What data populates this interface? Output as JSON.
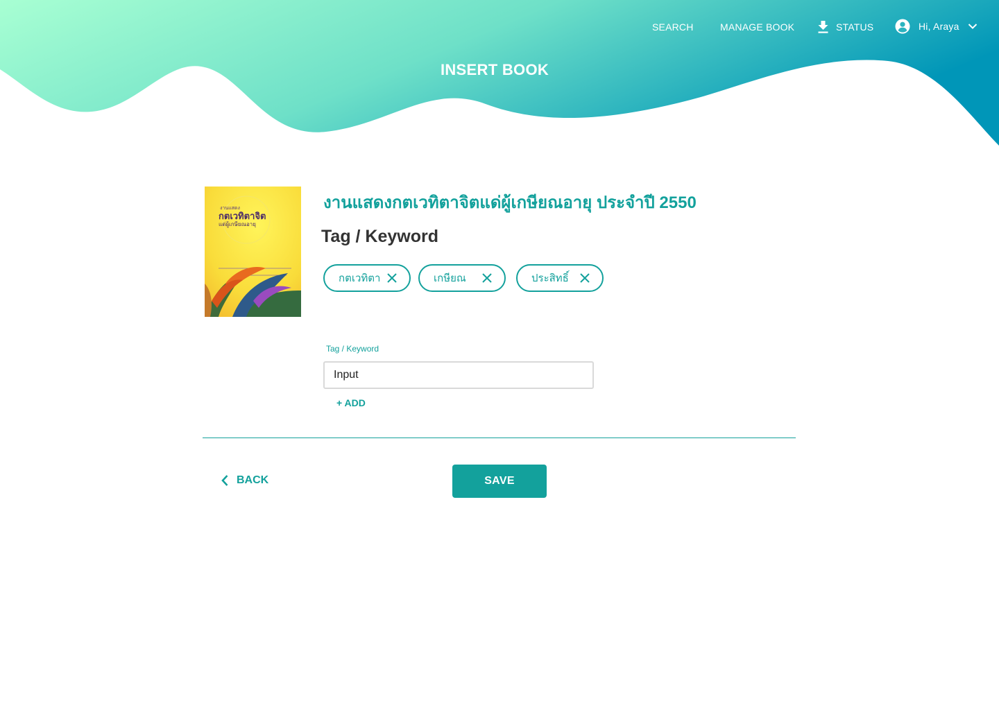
{
  "colors": {
    "accent": "#13a19c",
    "header_gradient_start": "#a8ffd3",
    "header_gradient_mid": "#6ee0c8",
    "header_gradient_end": "#0096b8",
    "text_dark": "#333333",
    "input_border": "#d9d9d9"
  },
  "nav": {
    "search_label": "SEARCH",
    "manage_book_label": "MANAGE BOOK",
    "status_label": "STATUS",
    "status_icon": "download-icon",
    "user_icon": "account-circle-icon",
    "user_greeting": "Hi, Araya",
    "user_menu_icon": "chevron-down-icon"
  },
  "page": {
    "title": "INSERT BOOK"
  },
  "book": {
    "title": "งานแสดงกตเวทิตาจิตแด่ผู้เกษียณอายุ ประจำปี 2550",
    "cover_text_line1": "งานแสดง",
    "cover_text_line2": "กตเวทิตาจิต",
    "cover_text_line3": "แด่ผู้เกษียณอายุ"
  },
  "tags": {
    "heading": "Tag / Keyword",
    "chips": [
      {
        "label": "กตเวทิตา",
        "remove_icon": "close-icon"
      },
      {
        "label": "เกษียณ",
        "remove_icon": "close-icon"
      },
      {
        "label": "ประสิทธิ์",
        "remove_icon": "close-icon"
      }
    ]
  },
  "form": {
    "field_label": "Tag / Keyword",
    "input_value": "Input",
    "add_label": "+ ADD"
  },
  "actions": {
    "back_label": "BACK",
    "back_icon": "chevron-left-icon",
    "save_label": "SAVE"
  }
}
